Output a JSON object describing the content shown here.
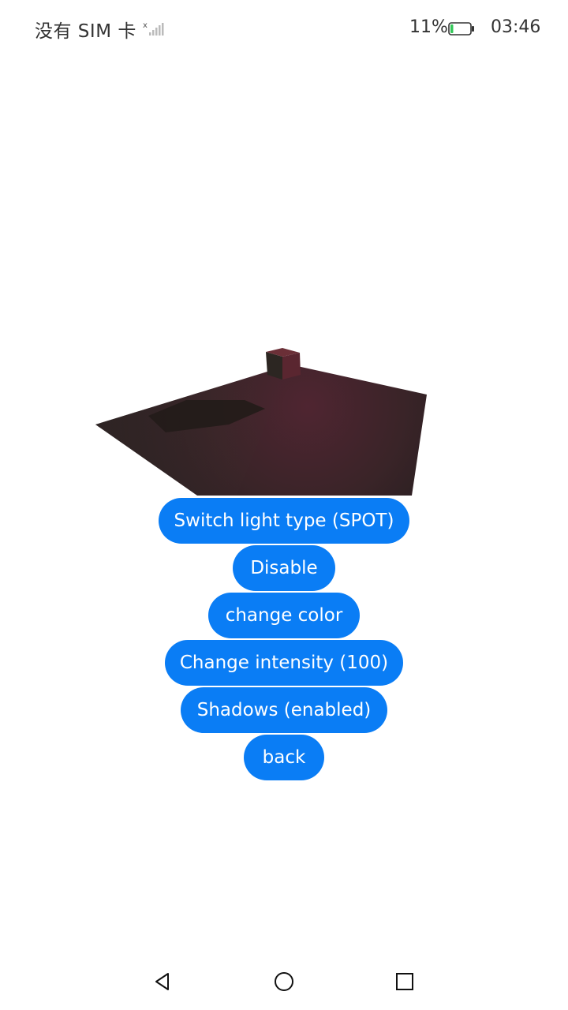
{
  "status_bar": {
    "carrier": "没有 SIM 卡",
    "battery_percent": "11%",
    "battery_level": 0.11,
    "time": "03:46",
    "icons": [
      "no-signal-icon",
      "battery-icon"
    ]
  },
  "scene": {
    "description_icon": "3d-scene-viewport",
    "colors": {
      "floor_light": "#4a2530",
      "floor_dark": "#1a1a1a",
      "shadow": "#231b19",
      "cube_top": "#6b2a34",
      "cube_side": "#2e2622"
    }
  },
  "buttons": {
    "light_type": "Switch light type (SPOT)",
    "disable": "Disable",
    "change_color": "change color",
    "change_intensity": "Change intensity (100)",
    "shadows": "Shadows (enabled)",
    "back": "back"
  },
  "nav_bar": {
    "icons": [
      "nav-back-icon",
      "nav-home-icon",
      "nav-recent-icon"
    ]
  },
  "colors": {
    "accent": "#0a7df5",
    "background": "#ffffff",
    "status_text": "#333333"
  }
}
